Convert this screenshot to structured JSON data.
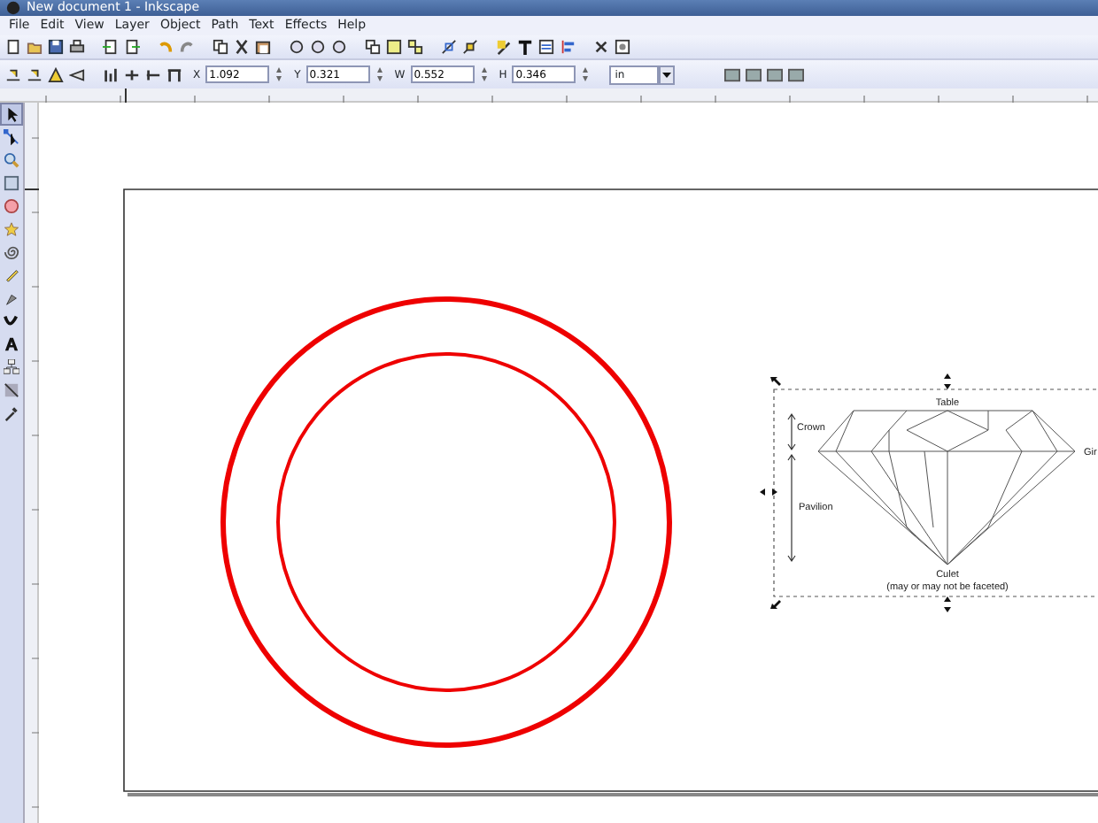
{
  "window": {
    "title": "New document 1 - Inkscape"
  },
  "menu": [
    {
      "label": "File"
    },
    {
      "label": "Edit"
    },
    {
      "label": "View"
    },
    {
      "label": "Layer"
    },
    {
      "label": "Object"
    },
    {
      "label": "Path"
    },
    {
      "label": "Text"
    },
    {
      "label": "Effects"
    },
    {
      "label": "Help"
    }
  ],
  "selection_toolbar": {
    "fields": [
      {
        "label": "X",
        "value": "1.092"
      },
      {
        "label": "Y",
        "value": "0.321"
      },
      {
        "label": "W",
        "value": "0.552"
      },
      {
        "label": "H",
        "value": "0.346"
      }
    ],
    "unit": "in"
  },
  "toolbox": [
    {
      "selected": true
    },
    {
      "selected": false
    },
    {
      "selected": false
    },
    {
      "selected": false
    },
    {
      "selected": false
    },
    {
      "selected": false
    },
    {
      "selected": false
    },
    {
      "selected": false
    },
    {
      "selected": false
    },
    {
      "selected": false
    },
    {
      "selected": false
    },
    {
      "selected": false
    },
    {
      "selected": false
    },
    {
      "selected": false
    }
  ],
  "diagram": {
    "labels": {
      "table": "Table",
      "crown": "Crown",
      "girdle": "Gir",
      "pavilion": "Pavilion",
      "culet": "Culet",
      "culet_note": "(may or may not be faceted)"
    }
  }
}
